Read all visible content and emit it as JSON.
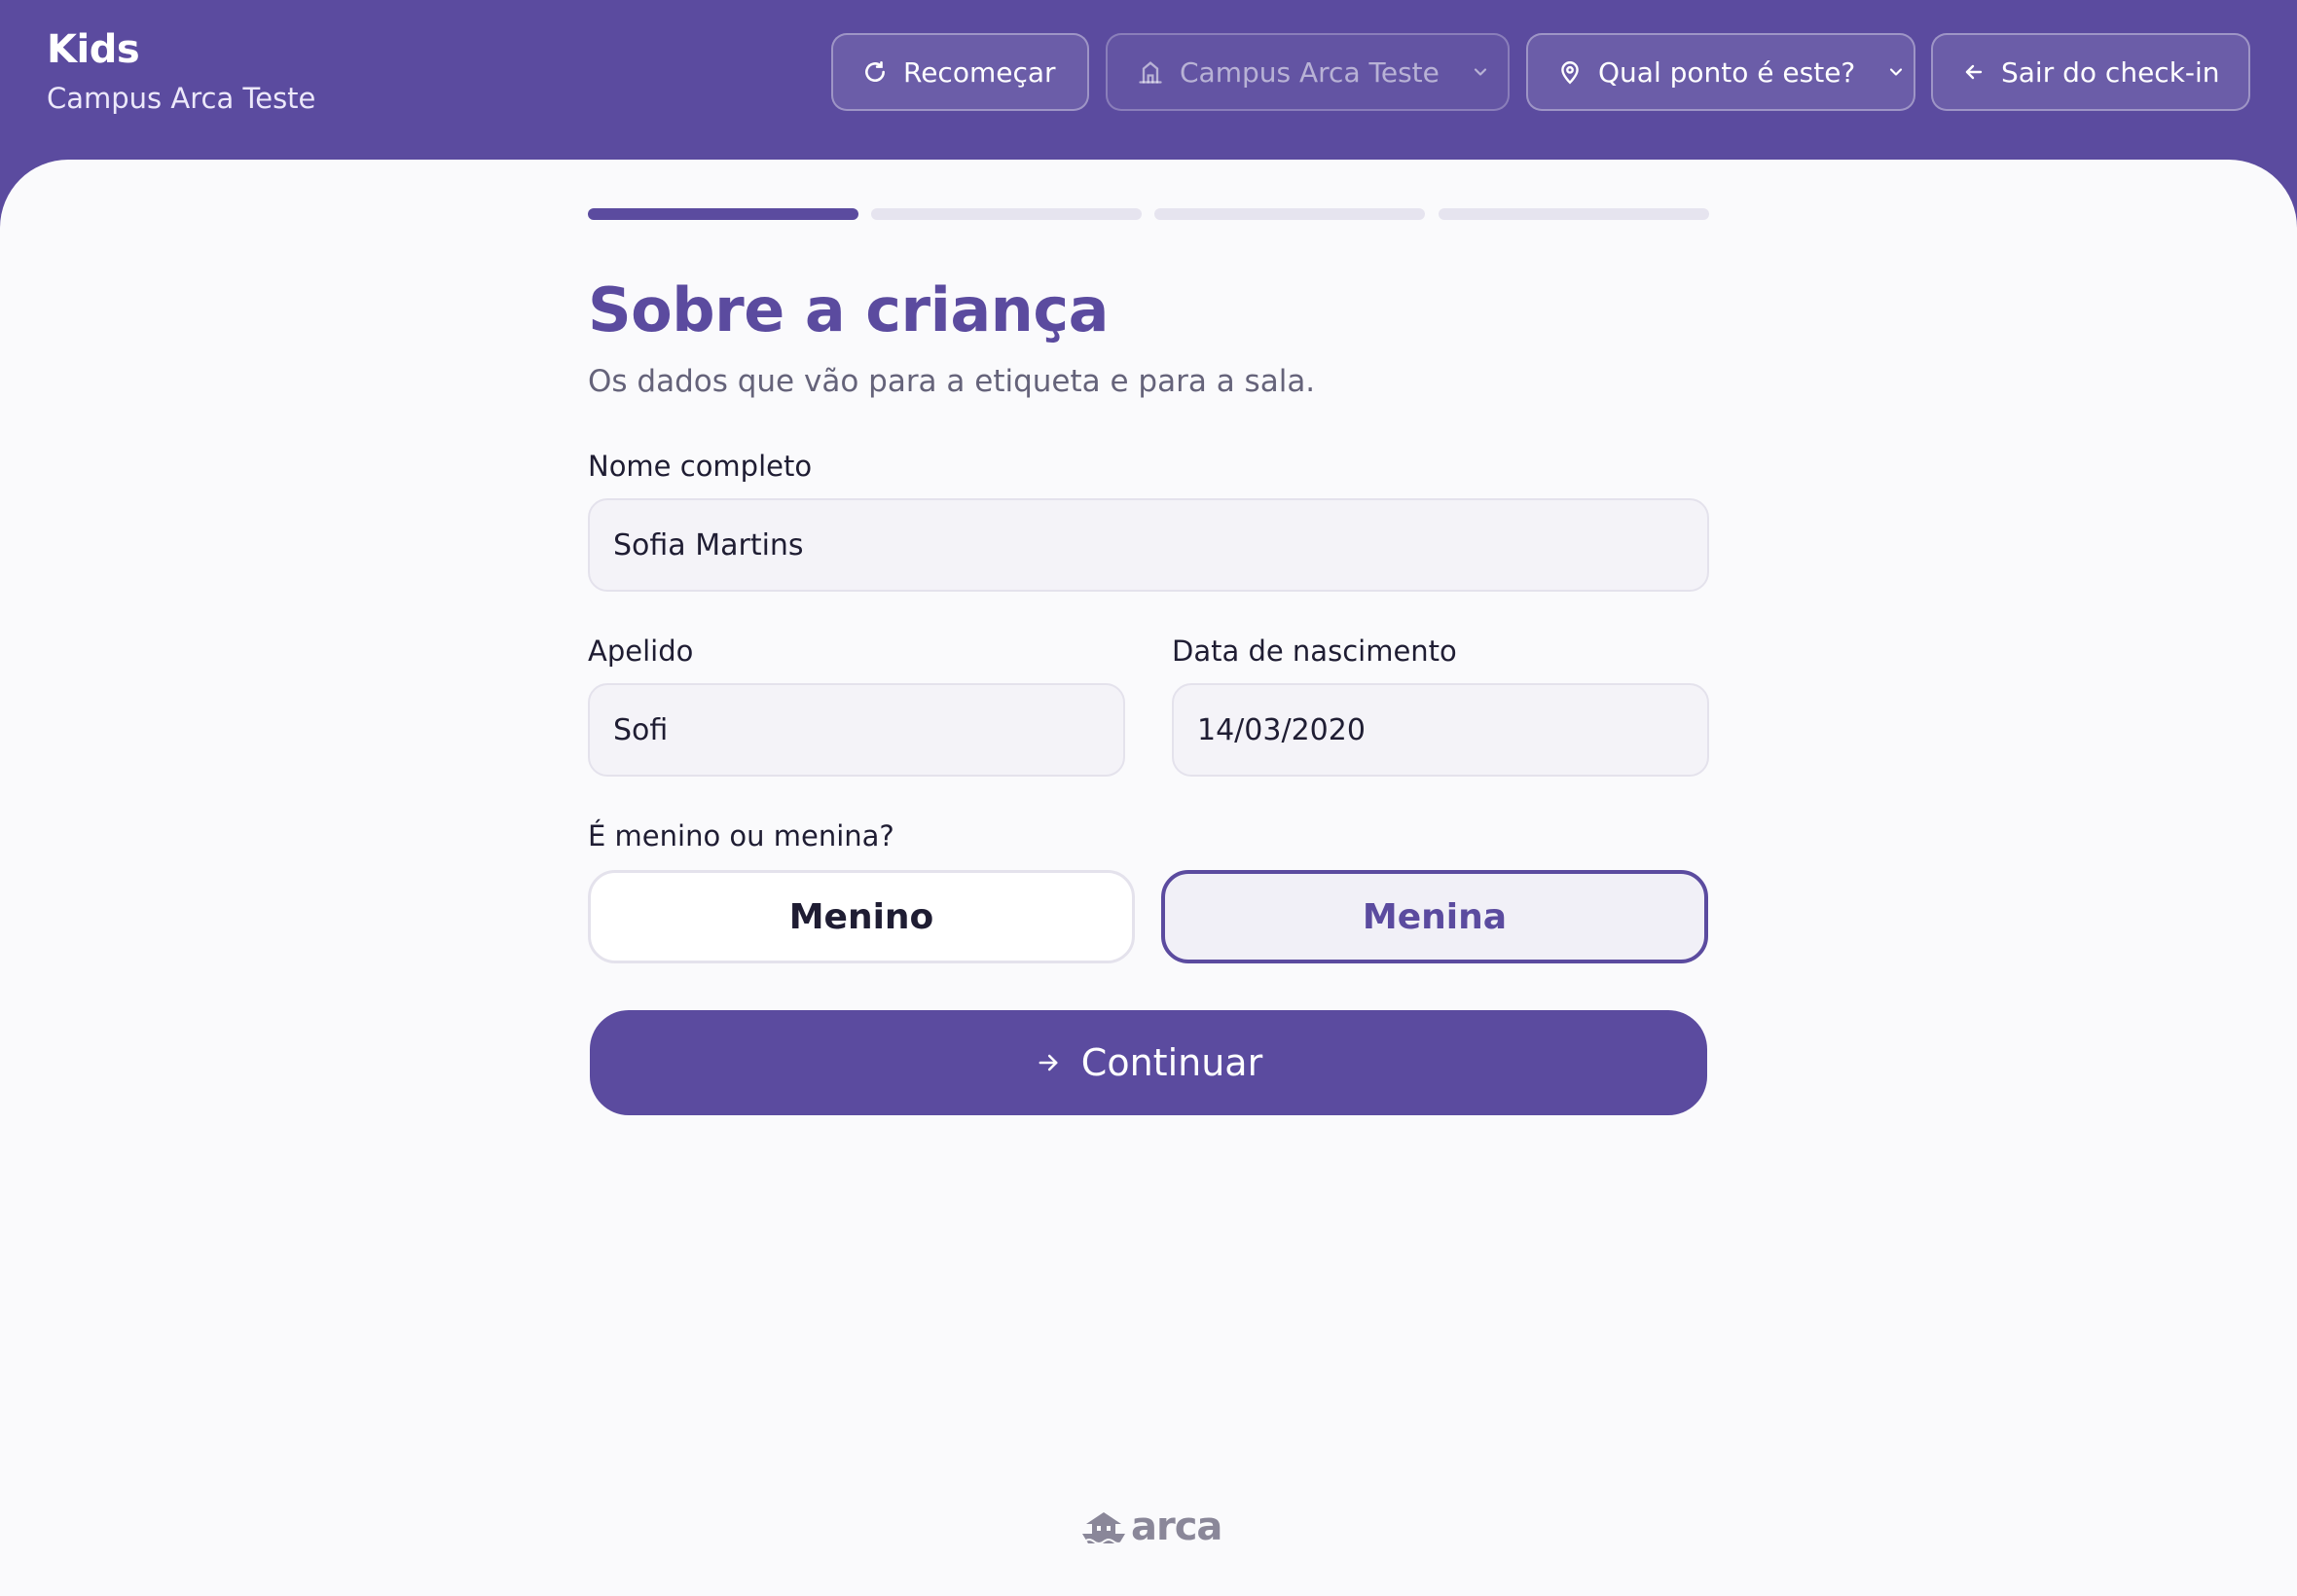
{
  "header": {
    "app_title": "Kids",
    "campus_name": "Campus Arca Teste",
    "restart_label": "Recomeçar",
    "campus_select_value": "Campus Arca Teste",
    "point_select_value": "Qual ponto é este?",
    "exit_label": "Sair do check-in"
  },
  "progress": {
    "current_step": 1,
    "total_steps": 4
  },
  "form": {
    "title": "Sobre a criança",
    "subtitle": "Os dados que vão para a etiqueta e para a sala.",
    "full_name": {
      "label": "Nome completo",
      "value": "Sofia Martins"
    },
    "nickname": {
      "label": "Apelido",
      "value": "Sofi"
    },
    "birth_date": {
      "label": "Data de nascimento",
      "value": "14/03/2020"
    },
    "gender": {
      "label": "É menino ou menina?",
      "options": [
        "Menino",
        "Menina"
      ],
      "selected": "Menina"
    },
    "continue_label": "Continuar"
  },
  "footer": {
    "logo_text": "arca"
  },
  "colors": {
    "primary": "#5b4b9f",
    "background": "#fafafc",
    "field_bg": "#f4f3f8"
  },
  "icons": {
    "restart": "refresh-icon",
    "campus": "building-icon",
    "point": "location-pin-icon",
    "dropdown": "chevron-down-icon",
    "exit": "arrow-left-icon",
    "continue": "arrow-right-icon",
    "logo": "ark-boat-icon"
  }
}
